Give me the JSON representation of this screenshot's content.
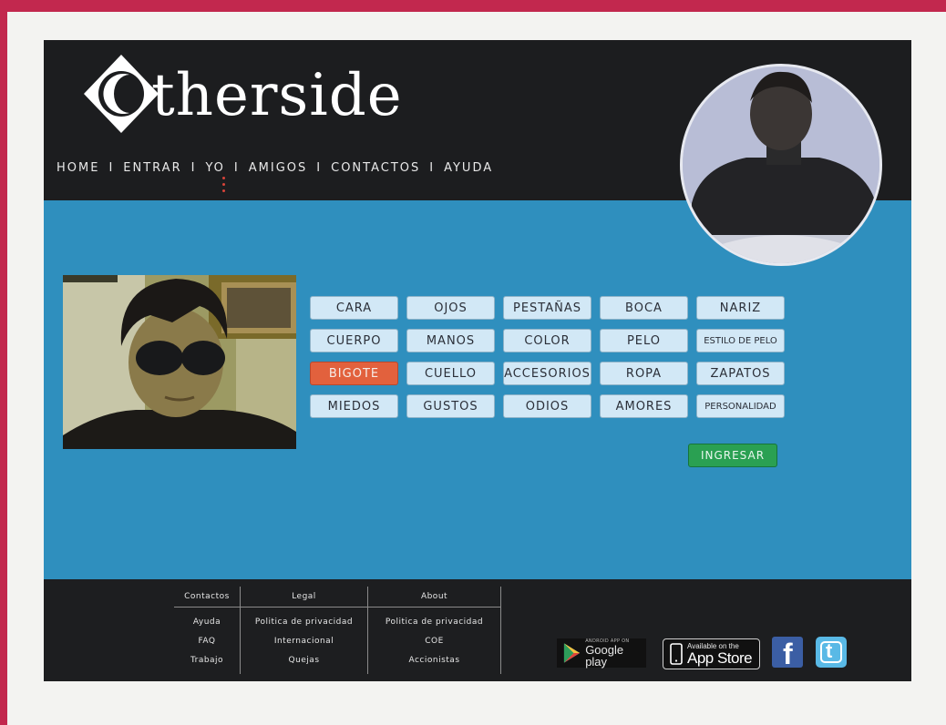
{
  "brand": {
    "logo_text": "therside"
  },
  "nav": {
    "items": [
      "HOME",
      "ENTRAR",
      "YO",
      "AMIGOS",
      "CONTACTOS",
      "AYUDA"
    ],
    "separator": "I",
    "active": "YO"
  },
  "traits": {
    "buttons": [
      "CARA",
      "OJOS",
      "PESTAÑAS",
      "BOCA",
      "NARIZ",
      "CUERPO",
      "MANOS",
      "COLOR",
      "PELO",
      "ESTILO DE PELO",
      "BIGOTE",
      "CUELLO",
      "ACCESORIOS",
      "ROPA",
      "ZAPATOS",
      "MIEDOS",
      "GUSTOS",
      "ODIOS",
      "AMORES",
      "PERSONALIDAD"
    ],
    "selected": "BIGOTE"
  },
  "submit": {
    "label": "INGRESAR"
  },
  "footer": {
    "col1": {
      "title": "Contactos",
      "links": [
        "Ayuda",
        "FAQ",
        "Trabajo"
      ]
    },
    "col2": {
      "title": "Legal",
      "links": [
        "Politica de privacidad",
        "Internacional",
        "Quejas"
      ]
    },
    "col3": {
      "title": "About",
      "links": [
        "Politica de privacidad",
        "COE",
        "Accionistas"
      ]
    }
  },
  "stores": {
    "google_small": "ANDROID APP ON",
    "google": "Google play",
    "apple_small": "Available on the",
    "apple": "App Store"
  },
  "social": {
    "facebook": "f",
    "twitter": "t"
  },
  "colors": {
    "header": "#1c1d1f",
    "body": "#2f8fbe",
    "button": "#d2e8f6",
    "selected": "#e2613d",
    "submit": "#2aa052"
  }
}
